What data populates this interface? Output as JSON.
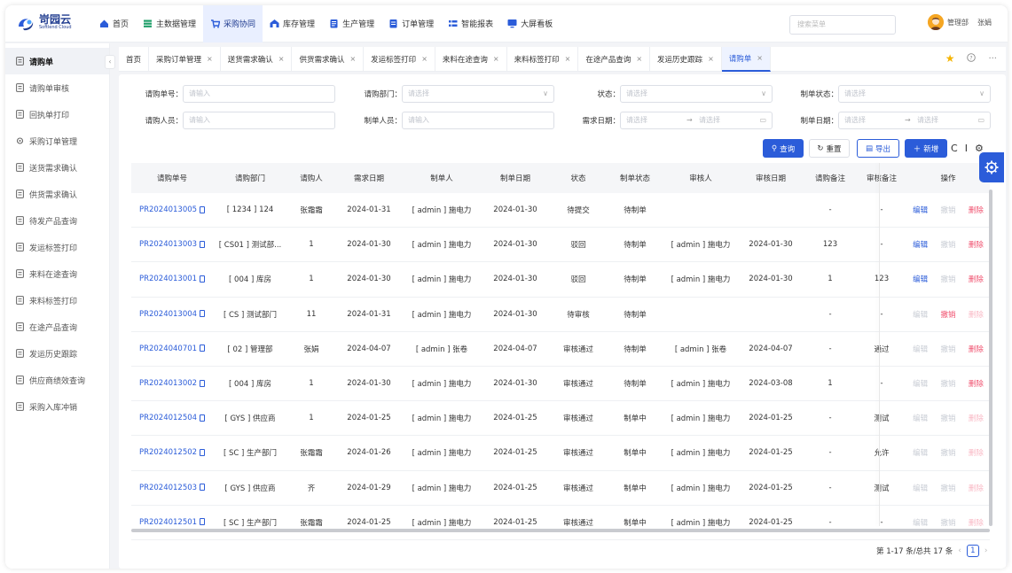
{
  "logo": {
    "cn": "岢园云",
    "en": "Softlend Cloud"
  },
  "topnav": {
    "items": [
      {
        "label": "首页",
        "icon": "home-icon",
        "color": "#2b5cd9"
      },
      {
        "label": "主数据管理",
        "icon": "layers-icon",
        "color": "#22a06b"
      },
      {
        "label": "采购协同",
        "icon": "cart-icon",
        "color": "#2b5cd9"
      },
      {
        "label": "库存管理",
        "icon": "warehouse-icon",
        "color": "#2b5cd9"
      },
      {
        "label": "生产管理",
        "icon": "clipboard-icon",
        "color": "#2b5cd9"
      },
      {
        "label": "订单管理",
        "icon": "order-icon",
        "color": "#2b5cd9"
      },
      {
        "label": "智能报表",
        "icon": "report-icon",
        "color": "#2b5cd9"
      },
      {
        "label": "大屏看板",
        "icon": "monitor-icon",
        "color": "#2b5cd9"
      }
    ],
    "active_index": 2,
    "search_placeholder": "搜索菜单",
    "department": "管理部",
    "user_name": "张娟"
  },
  "sidebar": {
    "items": [
      {
        "label": "请购单"
      },
      {
        "label": "请购单审核"
      },
      {
        "label": "回执单打印"
      },
      {
        "label": "采购订单管理"
      },
      {
        "label": "送货需求确认"
      },
      {
        "label": "供货需求确认"
      },
      {
        "label": "待发产品查询"
      },
      {
        "label": "发运标签打印"
      },
      {
        "label": "来料在途查询"
      },
      {
        "label": "来料标签打印"
      },
      {
        "label": "在途产品查询"
      },
      {
        "label": "发运历史跟踪"
      },
      {
        "label": "供应商绩效查询"
      },
      {
        "label": "采购入库冲销"
      }
    ],
    "active_index": 0
  },
  "tabs": [
    {
      "label": "首页",
      "closable": false
    },
    {
      "label": "采购订单管理",
      "closable": true
    },
    {
      "label": "送货需求确认",
      "closable": true
    },
    {
      "label": "供货需求确认",
      "closable": true
    },
    {
      "label": "发运标签打印",
      "closable": true
    },
    {
      "label": "来料在途查询",
      "closable": true
    },
    {
      "label": "来料标签打印",
      "closable": true
    },
    {
      "label": "在途产品查询",
      "closable": true
    },
    {
      "label": "发运历史跟踪",
      "closable": true
    },
    {
      "label": "请购单",
      "closable": true
    }
  ],
  "active_tab": 9,
  "tab_close_glyph": "×",
  "filters": {
    "req_no_label": "请购单号：",
    "req_no_placeholder": "请输入",
    "req_dept_label": "请购部门：",
    "req_dept_placeholder": "请选择",
    "status_label": "状态：",
    "status_placeholder": "请选择",
    "make_status_label": "制单状态：",
    "make_status_placeholder": "请选择",
    "requester_label": "请购人员：",
    "requester_placeholder": "请输入",
    "maker_label": "制单人员：",
    "maker_placeholder": "请输入",
    "need_date_label": "需求日期：",
    "need_date_start": "请选择",
    "need_date_end": "请选择",
    "make_date_label": "制单日期：",
    "make_date_start": "请选择",
    "make_date_end": "请选择",
    "range_sep": "→"
  },
  "buttons": {
    "query": "查询",
    "reset": "重置",
    "export": "导出",
    "add": "新增"
  },
  "table": {
    "columns": [
      "请购单号",
      "请购部门",
      "请购人",
      "需求日期",
      "制单人",
      "制单日期",
      "状态",
      "制单状态",
      "审核人",
      "审核日期",
      "请购备注",
      "审核备注",
      "操作"
    ],
    "action_labels": {
      "edit": "编辑",
      "revoke": "撤销",
      "delete": "删除"
    },
    "rows": [
      {
        "code": "PR2024013005",
        "dept": "[ 1234 ] 124",
        "requester": "张霜霜",
        "need_date": "2024-01-31",
        "maker": "[ admin ] 施电力",
        "make_date": "2024-01-30",
        "status": "待提交",
        "make_status": "待制单",
        "auditor": "",
        "audit_date": "",
        "req_note": "-",
        "audit_note": "-",
        "edit": "on",
        "revoke": "off",
        "delete": "on"
      },
      {
        "code": "PR2024013003",
        "dept": "[ CS01 ] 测试部...",
        "requester": "1",
        "need_date": "2024-01-30",
        "maker": "[ admin ] 施电力",
        "make_date": "2024-01-30",
        "status": "驳回",
        "make_status": "待制单",
        "auditor": "[ admin ] 施电力",
        "audit_date": "2024-01-30",
        "req_note": "123",
        "audit_note": "-",
        "edit": "on",
        "revoke": "off",
        "delete": "on"
      },
      {
        "code": "PR2024013001",
        "dept": "[ 004 ] 库房",
        "requester": "1",
        "need_date": "2024-01-30",
        "maker": "[ admin ] 施电力",
        "make_date": "2024-01-30",
        "status": "驳回",
        "make_status": "待制单",
        "auditor": "[ admin ] 施电力",
        "audit_date": "2024-01-30",
        "req_note": "1",
        "audit_note": "123",
        "edit": "on",
        "revoke": "off",
        "delete": "on"
      },
      {
        "code": "PR2024013004",
        "dept": "[ CS ] 测试部门",
        "requester": "11",
        "need_date": "2024-01-31",
        "maker": "[ admin ] 施电力",
        "make_date": "2024-01-30",
        "status": "待审核",
        "make_status": "待制单",
        "auditor": "",
        "audit_date": "",
        "req_note": "-",
        "audit_note": "-",
        "edit": "off",
        "revoke": "red",
        "delete": "off"
      },
      {
        "code": "PR2024040701",
        "dept": "[ 02 ] 管理部",
        "requester": "张娟",
        "need_date": "2024-04-07",
        "maker": "[ admin ] 张卷",
        "make_date": "2024-04-07",
        "status": "审核通过",
        "make_status": "待制单",
        "auditor": "[ admin ] 张卷",
        "audit_date": "2024-04-07",
        "req_note": "-",
        "audit_note": "通过",
        "edit": "off",
        "revoke": "off",
        "delete": "on"
      },
      {
        "code": "PR2024013002",
        "dept": "[ 004 ] 库房",
        "requester": "1",
        "need_date": "2024-01-30",
        "maker": "[ admin ] 施电力",
        "make_date": "2024-01-30",
        "status": "审核通过",
        "make_status": "待制单",
        "auditor": "[ admin ] 施电力",
        "audit_date": "2024-03-08",
        "req_note": "1",
        "audit_note": "-",
        "edit": "off",
        "revoke": "off",
        "delete": "on"
      },
      {
        "code": "PR2024012504",
        "dept": "[ GYS ] 供应商",
        "requester": "1",
        "need_date": "2024-01-25",
        "maker": "[ admin ] 施电力",
        "make_date": "2024-01-25",
        "status": "审核通过",
        "make_status": "制单中",
        "auditor": "[ admin ] 施电力",
        "audit_date": "2024-01-25",
        "req_note": "-",
        "audit_note": "测试",
        "edit": "off",
        "revoke": "off",
        "delete": "off"
      },
      {
        "code": "PR2024012502",
        "dept": "[ SC ] 生产部门",
        "requester": "张霜霜",
        "need_date": "2024-01-26",
        "maker": "[ admin ] 施电力",
        "make_date": "2024-01-25",
        "status": "审核通过",
        "make_status": "制单中",
        "auditor": "[ admin ] 施电力",
        "audit_date": "2024-01-25",
        "req_note": "-",
        "audit_note": "允许",
        "edit": "off",
        "revoke": "off",
        "delete": "off"
      },
      {
        "code": "PR2024012503",
        "dept": "[ GYS ] 供应商",
        "requester": "齐",
        "need_date": "2024-01-29",
        "maker": "[ admin ] 施电力",
        "make_date": "2024-01-25",
        "status": "审核通过",
        "make_status": "制单中",
        "auditor": "[ admin ] 施电力",
        "audit_date": "2024-01-25",
        "req_note": "-",
        "audit_note": "测试",
        "edit": "off",
        "revoke": "off",
        "delete": "off"
      },
      {
        "code": "PR2024012501",
        "dept": "[ SC ] 生产部门",
        "requester": "张霜霜",
        "need_date": "2024-01-25",
        "maker": "[ admin ] 施电力",
        "make_date": "2024-01-25",
        "status": "审核通过",
        "make_status": "制单中",
        "auditor": "[ admin ] 施电力",
        "audit_date": "2024-01-25",
        "req_note": "-",
        "audit_note": "-",
        "edit": "off",
        "revoke": "off",
        "delete": "off"
      }
    ]
  },
  "pagination": {
    "summary": "第 1-17 条/总共 17 条",
    "current_page": "1"
  },
  "colors": {
    "primary": "#2b5cd9",
    "danger": "#f0506e",
    "star": "#f5b400"
  }
}
